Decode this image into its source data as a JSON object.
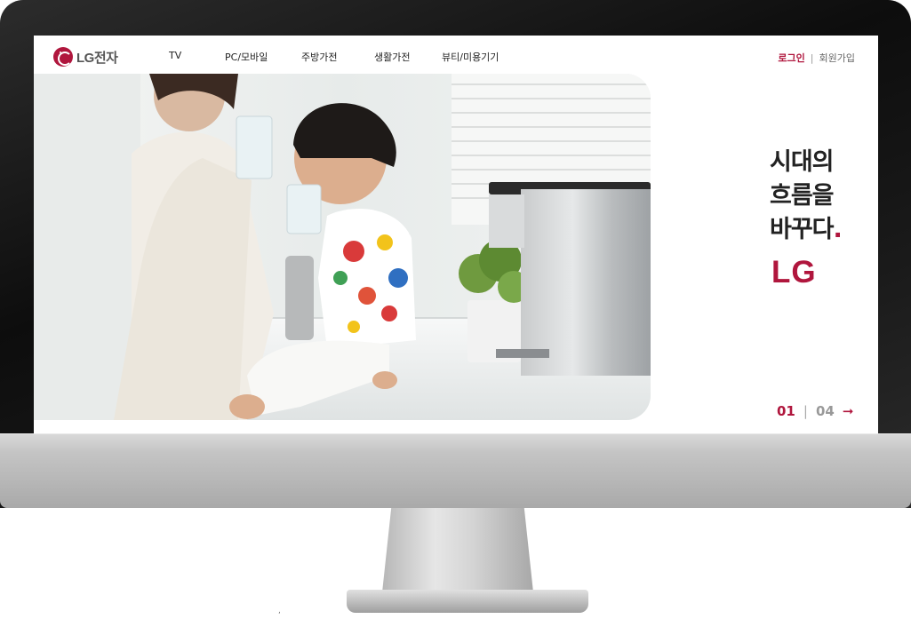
{
  "header": {
    "logo_text": "LG전자",
    "nav": [
      {
        "label": "TV"
      },
      {
        "label": "PC/모바일"
      },
      {
        "label": "주방가전"
      },
      {
        "label": "생활가전"
      },
      {
        "label": "뷰티/미용기기"
      }
    ],
    "login": "로그인",
    "separator": "|",
    "join": "회원가입"
  },
  "hero": {
    "slogan_line1": "시대의",
    "slogan_line2": "흐름을",
    "slogan_line3": "바꾸다",
    "slogan_dot": ".",
    "brand": "LG"
  },
  "pager": {
    "current": "01",
    "separator": "|",
    "total": "04",
    "next_icon": "arrow-right-icon",
    "next_glyph": "➞"
  },
  "colors": {
    "brand": "#b0163d",
    "text": "#222222"
  }
}
